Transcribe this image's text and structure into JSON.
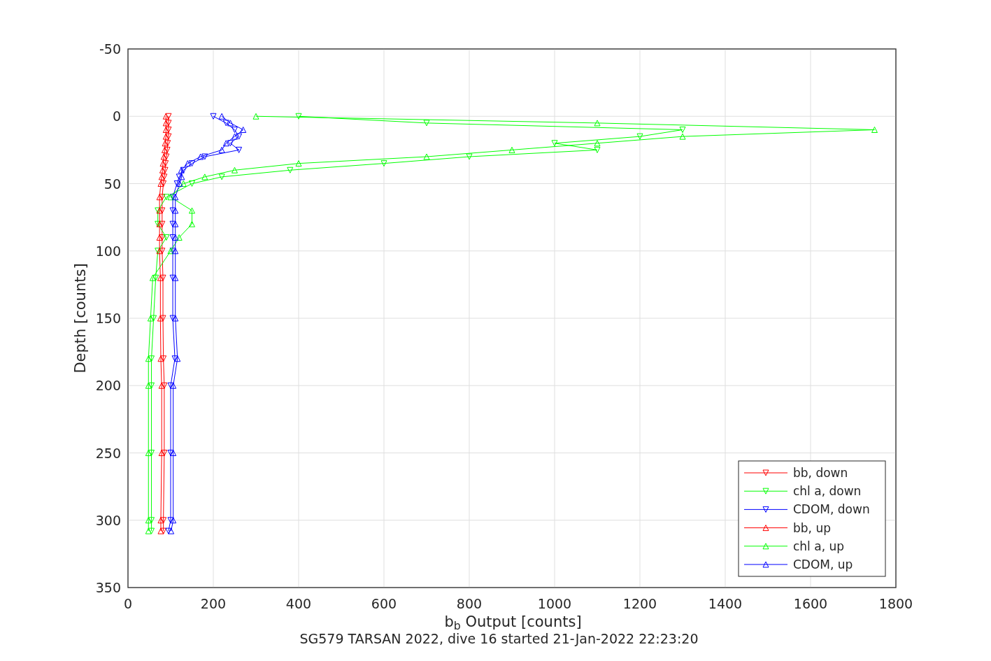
{
  "chart_data": {
    "type": "line",
    "orientation": "horizontal",
    "xlabel": "b$_{b}$ Output [counts]",
    "ylabel": "Depth [counts]",
    "x": [
      0,
      5,
      10,
      15,
      20,
      25,
      30,
      35,
      40,
      45,
      50,
      60,
      70,
      80,
      90,
      100,
      120,
      150,
      180,
      200,
      250,
      300,
      308
    ],
    "series": [
      {
        "name": "bb, down",
        "color": "#ff0000",
        "marker": "triangle-down",
        "values": [
          95,
          95,
          95,
          95,
          93,
          92,
          90,
          88,
          87,
          85,
          83,
          80,
          80,
          80,
          80,
          80,
          82,
          82,
          83,
          85,
          85,
          83,
          83
        ]
      },
      {
        "name": "chl a, down",
        "color": "#00ff00",
        "marker": "triangle-down",
        "values": [
          400,
          700,
          1300,
          1200,
          1000,
          1100,
          800,
          600,
          380,
          220,
          150,
          90,
          70,
          70,
          90,
          70,
          65,
          60,
          55,
          55,
          55,
          55,
          55
        ]
      },
      {
        "name": "CDOM, down",
        "color": "#0000ff",
        "marker": "triangle-down",
        "values": [
          200,
          230,
          250,
          260,
          240,
          260,
          180,
          150,
          130,
          120,
          115,
          105,
          105,
          105,
          105,
          105,
          105,
          105,
          110,
          100,
          100,
          100,
          95
        ]
      },
      {
        "name": "bb, up",
        "color": "#ff0000",
        "marker": "triangle-up",
        "values": [
          89,
          89,
          89,
          89,
          87,
          86,
          84,
          82,
          81,
          79,
          77,
          74,
          74,
          74,
          74,
          74,
          76,
          76,
          77,
          79,
          79,
          77,
          77
        ]
      },
      {
        "name": "chl a, up",
        "color": "#00ff00",
        "marker": "triangle-up",
        "values": [
          300,
          1100,
          1750,
          1300,
          1100,
          900,
          700,
          400,
          250,
          180,
          130,
          100,
          150,
          150,
          120,
          100,
          58,
          53,
          48,
          48,
          48,
          48,
          48
        ]
      },
      {
        "name": "CDOM, up",
        "color": "#0000ff",
        "marker": "triangle-up",
        "values": [
          220,
          240,
          270,
          250,
          230,
          220,
          170,
          140,
          125,
          126,
          121,
          111,
          111,
          111,
          111,
          111,
          111,
          111,
          116,
          106,
          106,
          106,
          101
        ]
      }
    ],
    "xlim": [
      0,
      1800
    ],
    "ylim": [
      350,
      -50
    ],
    "xticks": [
      0,
      200,
      400,
      600,
      800,
      1000,
      1200,
      1400,
      1600,
      1800
    ],
    "yticks": [
      -50,
      0,
      50,
      100,
      150,
      200,
      250,
      300,
      350
    ],
    "grid": true,
    "legend": true
  },
  "caption": "SG579 TARSAN 2022, dive 16 started 21-Jan-2022 22:23:20"
}
